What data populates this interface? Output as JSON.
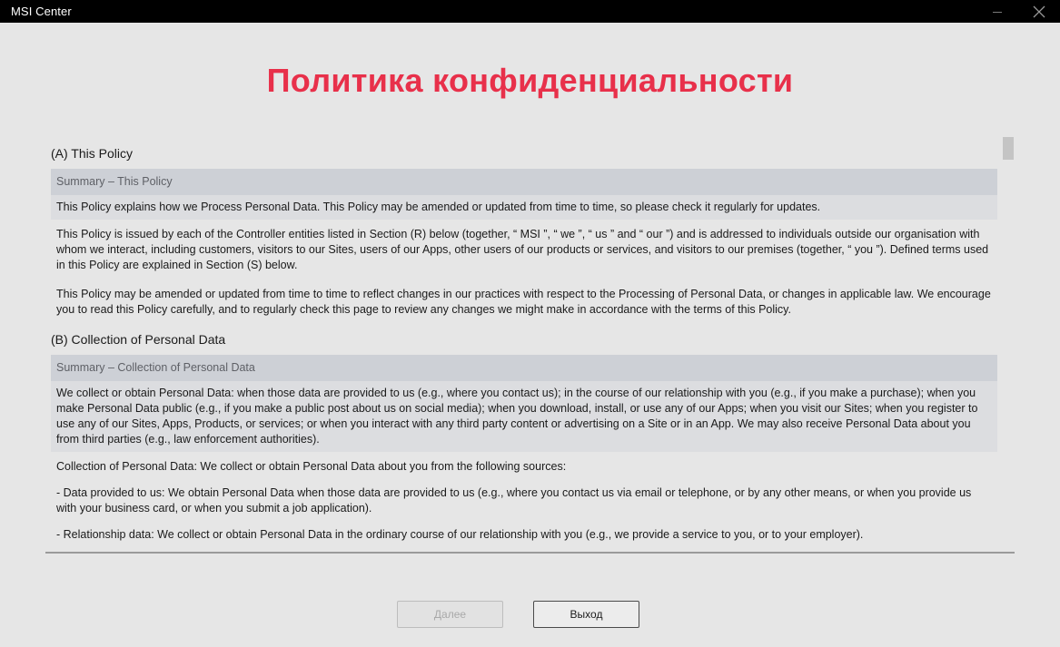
{
  "window": {
    "title": "MSI Center"
  },
  "page": {
    "heading": "Политика конфиденциальности"
  },
  "sections": {
    "a": {
      "title": "(A) This Policy",
      "summary_title": "Summary – This Policy",
      "summary_text": "This Policy explains how we Process Personal Data. This Policy may be amended or updated from time to time, so please check it regularly for updates.",
      "paragraphs": [
        "This Policy is issued by each of the Controller entities listed in Section (R) below (together, “ MSI ”, “ we ”, “ us ” and “ our ”) and is addressed to individuals outside our organisation with whom we interact, including customers, visitors to our Sites, users of our Apps, other users of our products or services, and visitors to our premises (together, “ you ”). Defined terms used in this Policy are explained in Section (S) below.",
        "This Policy may be amended or updated from time to time to reflect changes in our practices with respect to the Processing of Personal Data, or changes in applicable law. We encourage you to read this Policy carefully, and to regularly check this page to review any changes we might make in accordance with the terms of this Policy."
      ]
    },
    "b": {
      "title": "(B) Collection of Personal Data",
      "summary_title": "Summary – Collection of Personal Data",
      "summary_text": "We collect or obtain Personal Data: when those data are provided to us (e.g., where you contact us); in the course of our relationship with you (e.g., if you make a purchase); when you make Personal Data public (e.g., if you make a public post about us on social media); when you download, install, or use any of our Apps; when you visit our Sites; when you register to use any of our Sites, Apps, Products, or services; or when you interact with any third party content or advertising on a Site or in an App. We may also receive Personal Data about you from third parties (e.g., law enforcement authorities).",
      "paragraphs": [
        "Collection of Personal Data: We collect or obtain Personal Data about you from the following sources:",
        "- Data provided to us: We obtain Personal Data when those data are provided to us (e.g., where you contact us via email or telephone, or by any other means, or when you provide us with your business card, or when you submit a job application).",
        "- Relationship data: We collect or obtain Personal Data in the ordinary course of our relationship with you (e.g., we provide a service to you, or to your employer)."
      ]
    }
  },
  "buttons": {
    "next_label": "Далее",
    "exit_label": "Выход"
  },
  "icons": {
    "minimize": "minimize-icon",
    "close": "close-icon"
  },
  "colors": {
    "heading": "#e8304a",
    "titlebar": "#000000",
    "summary_header": "#cdd0d6",
    "summary_body": "#dcdde0"
  }
}
